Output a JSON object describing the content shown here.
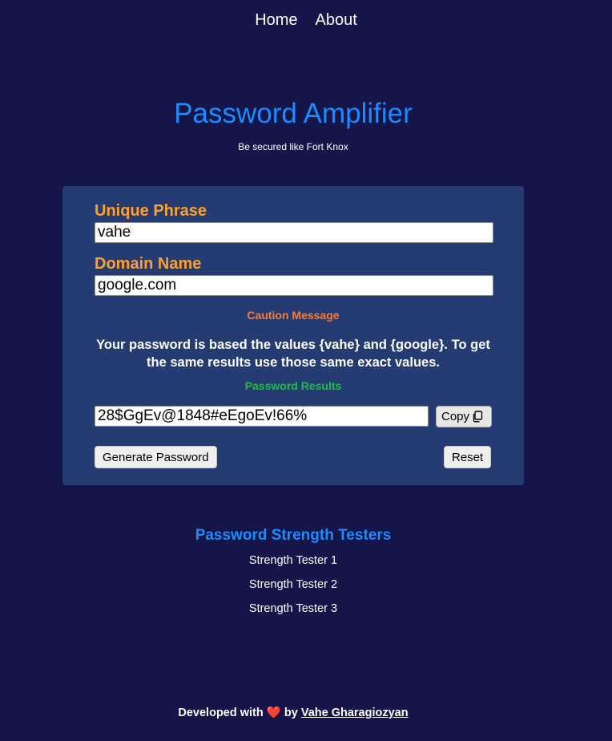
{
  "nav": {
    "home": "Home",
    "about": "About"
  },
  "header": {
    "title": "Password Amplifier",
    "subtitle": "Be secured like Fort Knox"
  },
  "form": {
    "phrase_label": "Unique Phrase",
    "phrase_value": "vahe",
    "domain_label": "Domain Name",
    "domain_value": "google.com",
    "caution_title": "Caution Message",
    "caution_text": "Your password is based the values {vahe} and {google}. To get the same results use those same exact values.",
    "results_title": "Password Results",
    "result_value": "28$GgEv@1848#eEgoEv!66%",
    "copy_label": "Copy",
    "copy_icon": "copy-icon",
    "generate_label": "Generate Password",
    "reset_label": "Reset"
  },
  "testers": {
    "title": "Password Strength Testers",
    "items": [
      "Strength Tester 1",
      "Strength Tester 2",
      "Strength Tester 3"
    ]
  },
  "footer": {
    "prefix": "Developed with",
    "heart": "❤️",
    "by": "by",
    "author": "Vahe Gharagiozyan"
  },
  "colors": {
    "background": "#15154a",
    "card": "#253c73",
    "title_blue": "#1a8cff",
    "label_orange": "#ff9f2e",
    "caution_orange": "#ff7a2e",
    "results_green": "#16c23f"
  }
}
